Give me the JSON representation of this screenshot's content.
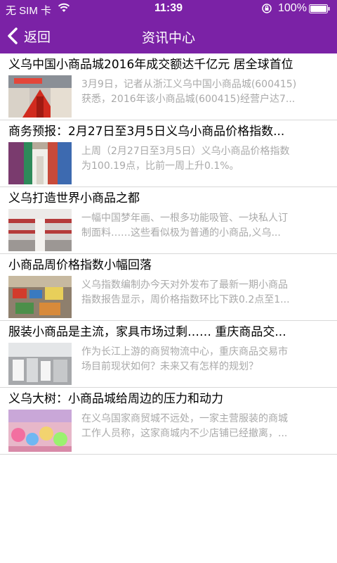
{
  "status_bar": {
    "carrier": "无 SIM 卡",
    "time": "11:39",
    "battery_percent": "100%"
  },
  "nav": {
    "back_label": "返回",
    "title": "资讯中心"
  },
  "colors": {
    "header_bg": "#7b22a6",
    "summary_text": "#a9a9a9",
    "divider": "#d8d8d8"
  },
  "news": [
    {
      "title": "义乌中国小商品城2016年成交额达千亿元 居全球首位",
      "summary_line1": "3月9日，记者从浙江义乌中国小商品城(600415)",
      "summary_line2": "获悉，2016年该小商品城(600415)经营户达7...",
      "thumb_icon": "market-photo"
    },
    {
      "title": "商务预报：2月27日至3月5日义乌小商品价格指数...",
      "summary_line1": "上周（2月27日至3月5日）义乌小商品价格指数",
      "summary_line2": "为100.19点，比前一周上升0.1%。",
      "thumb_icon": "market-photo"
    },
    {
      "title": "义乌打造世界小商品之都",
      "summary_line1": "一幅中国梦年画、一根多功能吸管、一块私人订",
      "summary_line2": "制面料……这些看似极为普通的小商品,义乌...",
      "thumb_icon": "market-photo"
    },
    {
      "title": "小商品周价格指数小幅回落",
      "summary_line1": "义乌指数编制办今天对外发布了最新一期小商品",
      "summary_line2": "指数报告显示，周价格指数环比下跌0.2点至1...",
      "thumb_icon": "market-photo"
    },
    {
      "title": "服装小商品是主流，家具市场过剩…… 重庆商品交...",
      "summary_line1": "作为长江上游的商贸物流中心，重庆商品交易市",
      "summary_line2": "场目前现状如何？未来又有怎样的规划？",
      "thumb_icon": "market-photo"
    },
    {
      "title": "义乌大树：小商品城给周边的压力和动力",
      "summary_line1": "在义乌国家商贸城不远处，一家主营服装的商城",
      "summary_line2": "工作人员称，这家商城内不少店铺已经撤离，...",
      "thumb_icon": "market-photo"
    }
  ]
}
